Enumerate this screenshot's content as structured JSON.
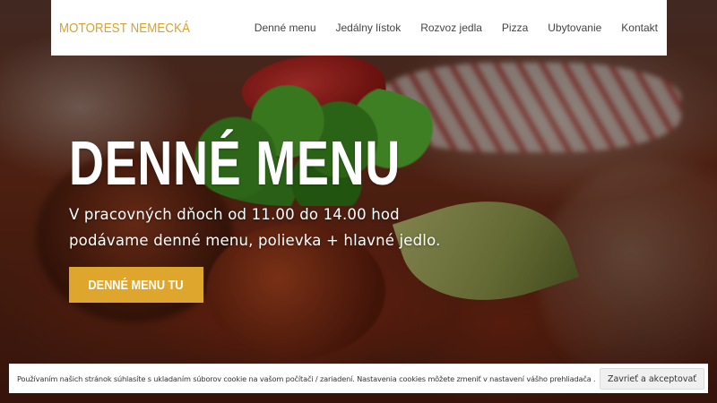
{
  "header": {
    "logo": "MOTOREST NEMECKÁ",
    "nav": [
      {
        "label": "Denné menu"
      },
      {
        "label": "Jedálny lístok"
      },
      {
        "label": "Rozvoz jedla"
      },
      {
        "label": "Pizza"
      },
      {
        "label": "Ubytovanie"
      },
      {
        "label": "Kontakt"
      }
    ]
  },
  "hero": {
    "title": "DENNÉ MENU",
    "subtitle_line1": "V pracovných dňoch od 11.00 do 14.00 hod",
    "subtitle_line2": "podávame denné menu, polievka + hlavné jedlo.",
    "cta_label": "DENNÉ MENU TU"
  },
  "cookie_bar": {
    "text": "Používaním našich stránok súhlasíte s ukladaním súborov cookie na vašom počítači / zariadení. Nastavenia cookies môžete zmeniť v nastavení vášho prehliadača .",
    "button_label": "Zavrieť a akceptovať"
  },
  "colors": {
    "accent": "#dea62d",
    "logo": "#d4a22d",
    "header_bg": "#ffffff",
    "nav_text": "#444444"
  }
}
